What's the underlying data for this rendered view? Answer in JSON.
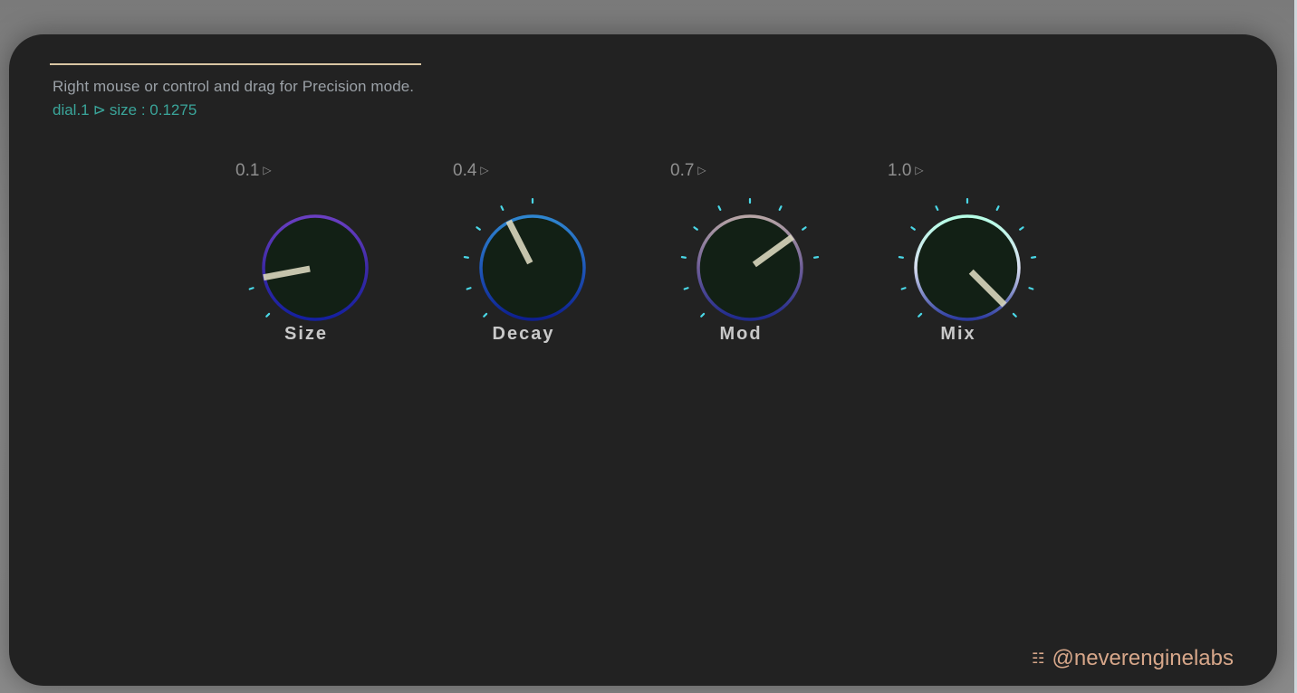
{
  "instructions": {
    "hint": "Right mouse or control and drag for Precision mode.",
    "status_target": "dial.1",
    "status_separator": "⊳",
    "status_param": "size : 0.1275"
  },
  "dials": [
    {
      "label": "Size",
      "value_text": "0.1",
      "arrow": "▷",
      "value": 0.1275,
      "tick_count": 2,
      "ring_colors": [
        "#6a3fc2",
        "#3d2aa6",
        "#1420a0"
      ]
    },
    {
      "label": "Decay",
      "value_text": "0.4",
      "arrow": "▷",
      "value": 0.4,
      "tick_count": 6,
      "ring_colors": [
        "#2f86d0",
        "#1f58b8",
        "#0e1f8f"
      ]
    },
    {
      "label": "Mod",
      "value_text": "0.7",
      "arrow": "▷",
      "value": 0.7,
      "tick_count": 9,
      "ring_colors": [
        "#b8a6a6",
        "#6f5e98",
        "#1f2a8e"
      ]
    },
    {
      "label": "Mix",
      "value_text": "1.0",
      "arrow": "▷",
      "value": 1.0,
      "tick_count": 11,
      "ring_colors": [
        "#b6ffe6",
        "#d9def0",
        "#2b3aa0"
      ]
    }
  ],
  "colors": {
    "panel": "#222222",
    "knob_face": "#122015",
    "pointer": "#d9d6bd",
    "tick": "#4ad7e6",
    "credit": "#d7a78a"
  },
  "credit": {
    "icon": "grid-logo-icon",
    "text": "@neverenginelabs"
  }
}
